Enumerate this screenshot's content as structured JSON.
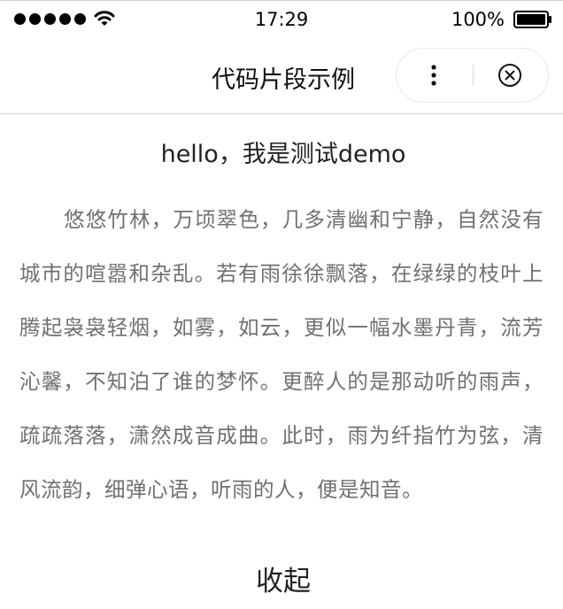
{
  "status_bar": {
    "time": "17:29",
    "battery_percent": "100%",
    "icons": [
      "signal-dots-icon",
      "wifi-icon",
      "battery-icon"
    ]
  },
  "nav_bar": {
    "title": "代码片段示例",
    "capsule": {
      "more_icon": "more-dots-icon",
      "close_icon": "close-circle-icon"
    }
  },
  "content": {
    "heading": "hello，我是测试demo",
    "paragraph": "悠悠竹林，万顷翠色，几多清幽和宁静，自然没有城市的喧嚣和杂乱。若有雨徐徐飘落，在绿绿的枝叶上腾起袅袅轻烟，如雾，如云，更似一幅水墨丹青，流芳沁馨，不知泊了谁的梦怀。更醉人的是那动听的雨声，疏疏落落，潇然成音成曲。此时，雨为纤指竹为弦，清风流韵，细弹心语，听雨的人，便是知音。",
    "collapse_label": "收起"
  },
  "colors": {
    "text_primary": "#222222",
    "text_secondary": "#707070",
    "divider": "#d9d9d9",
    "background": "#ffffff"
  }
}
